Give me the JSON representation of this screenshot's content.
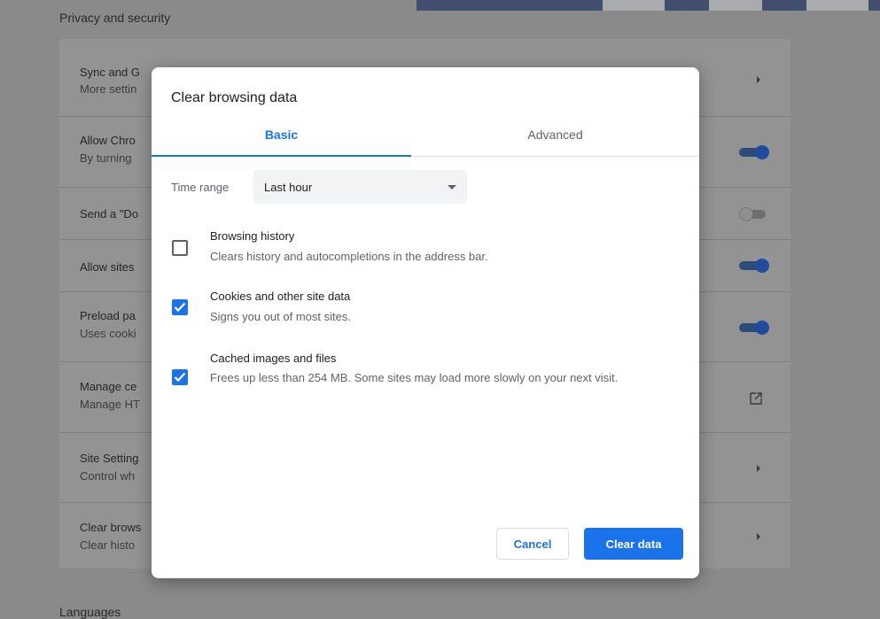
{
  "background": {
    "section_title": "Privacy and security",
    "footer_section_title": "Languages",
    "rows": [
      {
        "label": "Sync and G",
        "sub": "More settin",
        "control": "chevron"
      },
      {
        "label": "Allow Chro",
        "sub": "By turning",
        "control": "toggle-on"
      },
      {
        "label": "Send a \"Do",
        "sub": "",
        "control": "toggle-off"
      },
      {
        "label": "Allow sites",
        "sub": "",
        "control": "toggle-on"
      },
      {
        "label": "Preload pa",
        "sub": "Uses cooki",
        "control": "toggle-on"
      },
      {
        "label": "Manage ce",
        "sub": "Manage HT",
        "control": "external"
      },
      {
        "label": "Site Setting",
        "sub": "Control wh",
        "control": "chevron"
      },
      {
        "label": "Clear brows",
        "sub": "Clear histo",
        "control": "chevron"
      }
    ]
  },
  "dialog": {
    "title": "Clear browsing data",
    "tabs": [
      {
        "label": "Basic",
        "selected": true
      },
      {
        "label": "Advanced",
        "selected": false
      }
    ],
    "time_range": {
      "label": "Time range",
      "selected": "Last hour"
    },
    "items": [
      {
        "title": "Browsing history",
        "description": "Clears history and autocompletions in the address bar.",
        "checked": false
      },
      {
        "title": "Cookies and other site data",
        "description": "Signs you out of most sites.",
        "checked": true
      },
      {
        "title": "Cached images and files",
        "description": "Frees up less than 254 MB. Some sites may load more slowly on your next visit.",
        "checked": true
      }
    ],
    "cancel_label": "Cancel",
    "clear_label": "Clear data"
  },
  "colors": {
    "accent": "#1a73e8",
    "scrim": "#8a8a8a"
  }
}
